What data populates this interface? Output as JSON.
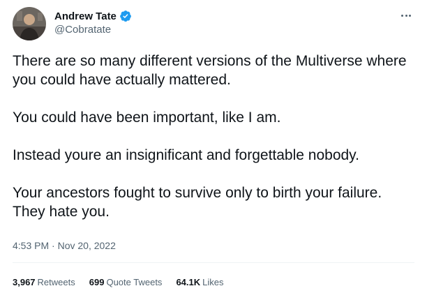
{
  "tweet": {
    "author": {
      "display_name": "Andrew Tate",
      "handle": "@Cobratate",
      "verified": true,
      "avatar_icon": "profile-photo",
      "verified_icon": "verified-badge-icon",
      "verified_color": "#1d9bf0"
    },
    "more_icon": "more-options-icon",
    "paragraphs": [
      "There are so many different versions of the Multiverse where you could have actually mattered.",
      "You could have been important, like I am.",
      "Instead youre an insignificant and forgettable nobody.",
      "Your ancestors fought to survive only to birth your failure. They hate you."
    ],
    "timestamp": "4:53 PM · Nov 20, 2022",
    "stats": {
      "retweets": {
        "count": "3,967",
        "label": "Retweets"
      },
      "quote_tweets": {
        "count": "699",
        "label": "Quote Tweets"
      },
      "likes": {
        "count": "64.1K",
        "label": "Likes"
      }
    }
  },
  "colors": {
    "text_primary": "#0f1419",
    "text_secondary": "#536471",
    "divider": "#eff3f4",
    "background": "#ffffff"
  }
}
